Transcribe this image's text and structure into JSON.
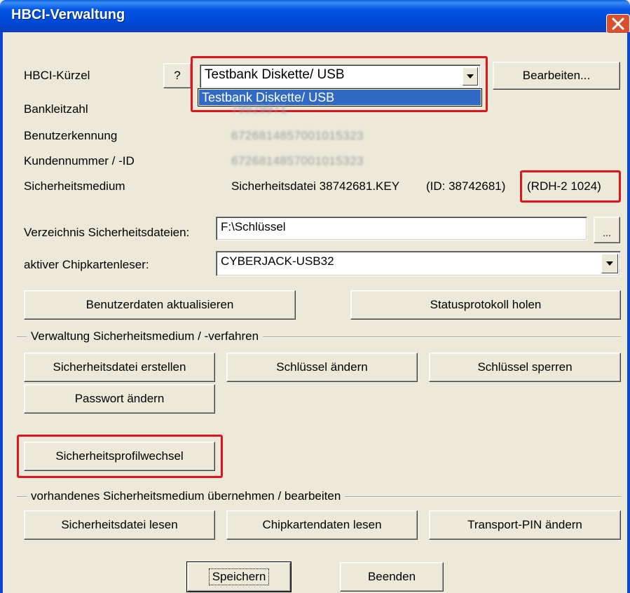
{
  "window": {
    "title": "HBCI-Verwaltung"
  },
  "labels": {
    "kuerzel": "HBCI-Kürzel",
    "blz": "Bankleitzahl",
    "benutzer": "Benutzerkennung",
    "kunde": "Kundennummer / -ID",
    "medium": "Sicherheitsmedium",
    "verzeichnis": "Verzeichnis Sicherheitsdateien:",
    "leser": "aktiver Chipkartenleser:"
  },
  "values": {
    "kuerzel_selected": "Testbank Diskette/ USB",
    "kuerzel_dropdown_option": "Testbank Diskette/ USB",
    "blz": "79929971",
    "benutzer": "6726814857001015323",
    "kunde": "6726814857001015323",
    "medium_file": "Sicherheitsdatei 38742681.KEY",
    "medium_id": "(ID: 38742681)",
    "medium_rdh": "(RDH-2  1024)",
    "verzeichnis": "F:\\Schlüssel",
    "leser": "CYBERJACK-USB32"
  },
  "buttons": {
    "help": "?",
    "bearbeiten": "Bearbeiten...",
    "browse": "...",
    "benutzerdaten": "Benutzerdaten aktualisieren",
    "statusprotokoll": "Statusprotokoll holen",
    "sicherheitsdatei_erstellen": "Sicherheitsdatei erstellen",
    "schluessel_aendern": "Schlüssel ändern",
    "schluessel_sperren": "Schlüssel sperren",
    "passwort_aendern": "Passwort ändern",
    "profilwechsel": "Sicherheitsprofilwechsel",
    "sicherheitsdatei_lesen": "Sicherheitsdatei lesen",
    "chipkartendaten_lesen": "Chipkartendaten lesen",
    "transport_pin": "Transport-PIN ändern",
    "speichern": "Speichern",
    "beenden": "Beenden"
  },
  "groups": {
    "verwaltung": "Verwaltung Sicherheitsmedium / -verfahren",
    "uebernehmen": "vorhandenes Sicherheitsmedium übernehmen / bearbeiten"
  },
  "colors": {
    "highlight_red": "#e0141e",
    "selection_blue": "#316ac5",
    "titlebar_blue": "#0055e5",
    "dialog_bg": "#ece9d8"
  },
  "icons": {
    "close": "close-icon",
    "dropdown": "chevron-down-icon"
  }
}
